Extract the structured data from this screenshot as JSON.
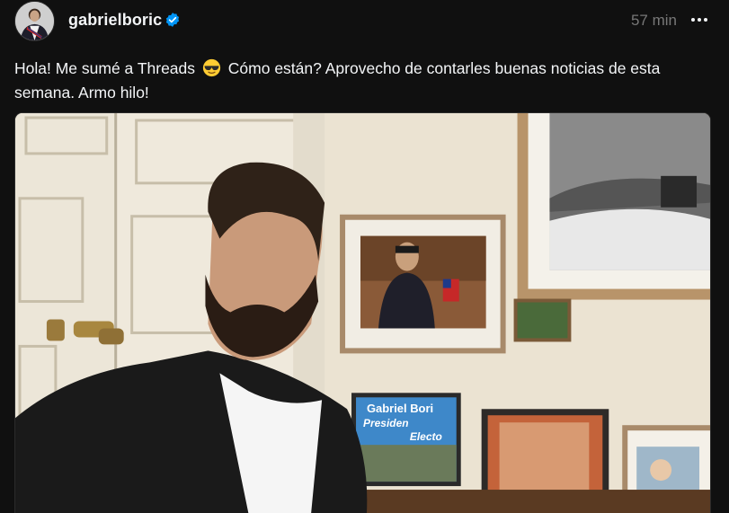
{
  "post": {
    "username": "gabrielboric",
    "timestamp": "57 min",
    "text_before_emoji": "Hola! Me sumé a Threads",
    "emoji": "smiling-face-with-sunglasses",
    "text_after_emoji": "Cómo están? Aprovecho de contarles buenas noticias de esta semana. Armo hilo!",
    "photo": {
      "sign_text_line1": "Gabriel Bori",
      "sign_text_line2": "Presiden",
      "sign_text_line3": "Electo"
    }
  },
  "colors": {
    "background": "#101010",
    "text": "#f3f5f7",
    "muted": "#777777",
    "verified": "#0095f6"
  },
  "icons": {
    "verified": "verified-badge-icon",
    "more": "more-options-icon"
  }
}
